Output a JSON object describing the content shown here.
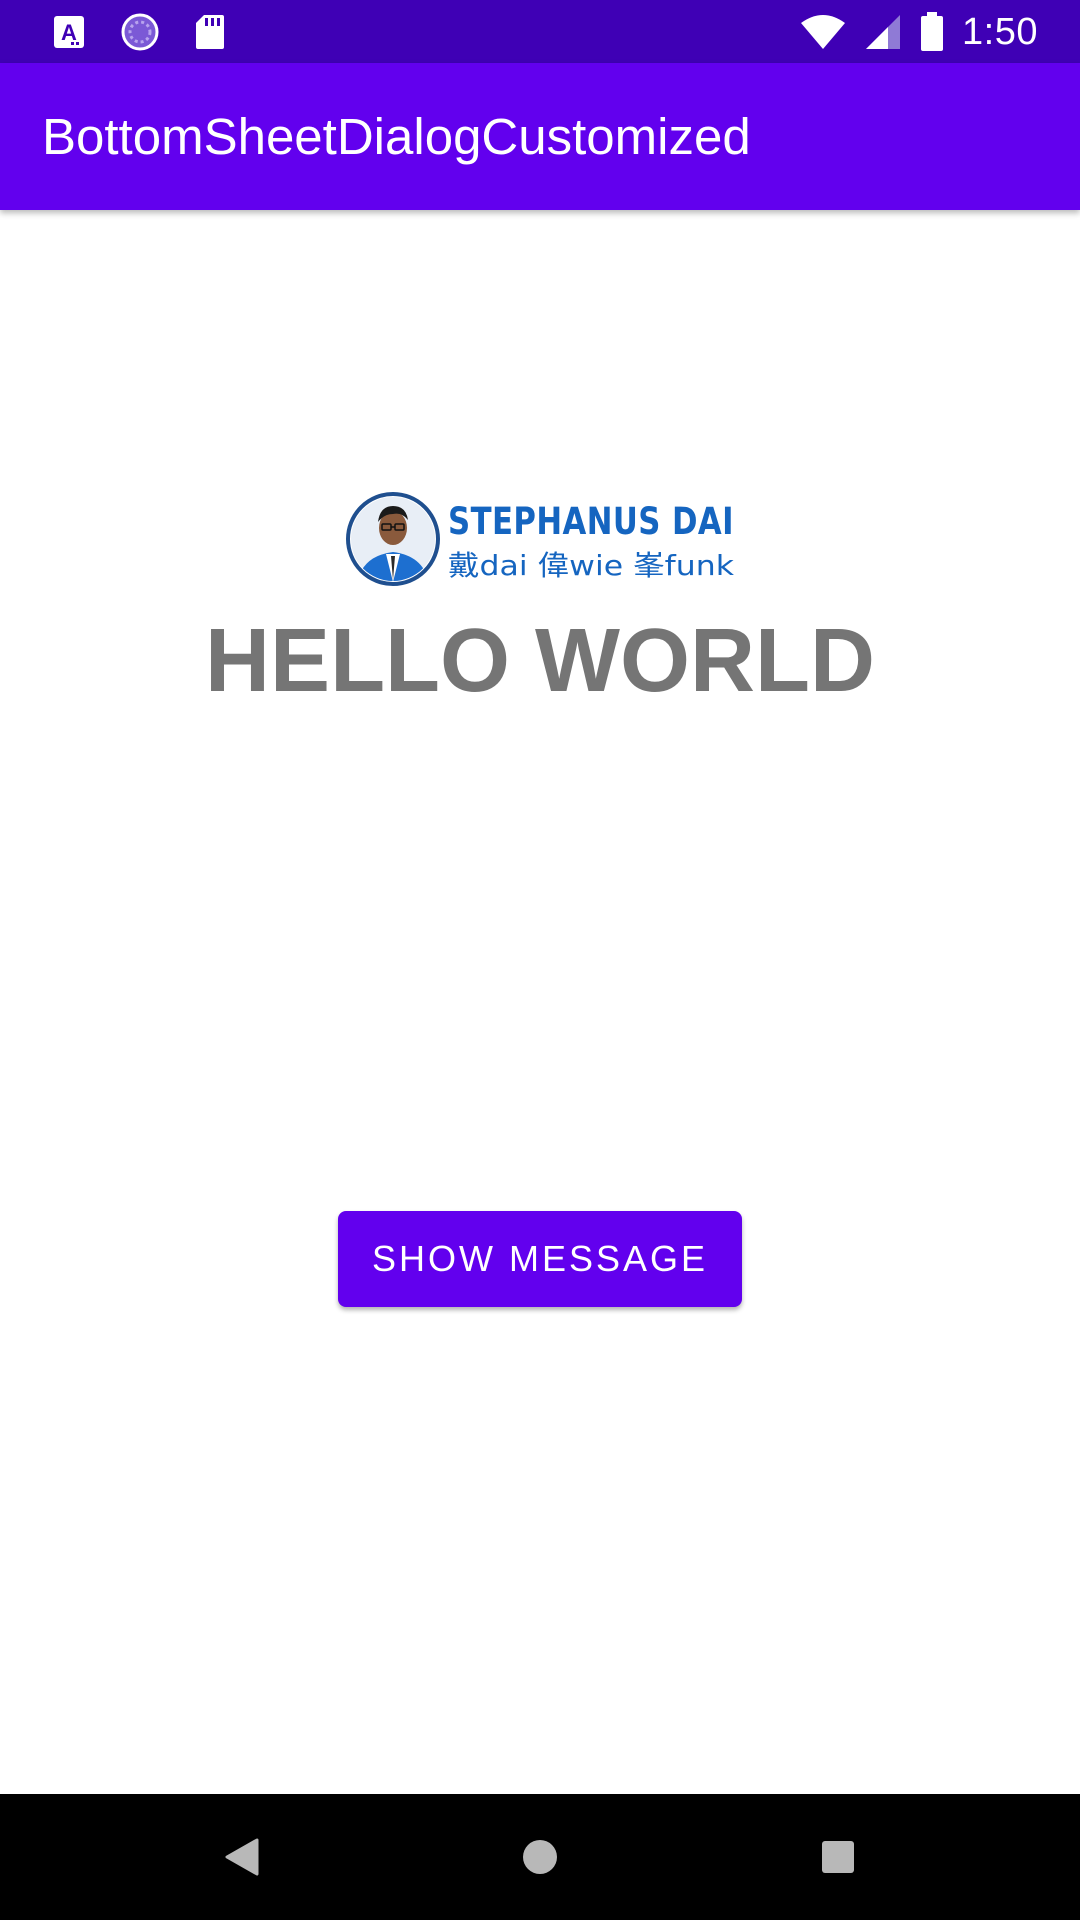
{
  "status_bar": {
    "time": "1:50",
    "left_icons": [
      "a-notification-icon",
      "sync-progress-icon",
      "sd-card-icon"
    ],
    "right_icons": [
      "wifi-icon",
      "cell-signal-icon",
      "battery-icon"
    ],
    "background": "#3f00b5"
  },
  "app_bar": {
    "title": "BottomSheetDialogCustomized",
    "background": "#6200ee"
  },
  "logo": {
    "line1": "STEPHANUS DAI",
    "line2": "戴dai 偉wie 峯funk",
    "color": "#1565c0"
  },
  "main": {
    "heading": "HELLO WORLD",
    "button_label": "SHOW MESSAGE",
    "accent": "#6200ee"
  },
  "nav_bar": {
    "icons": [
      "back-icon",
      "home-icon",
      "recents-icon"
    ]
  }
}
